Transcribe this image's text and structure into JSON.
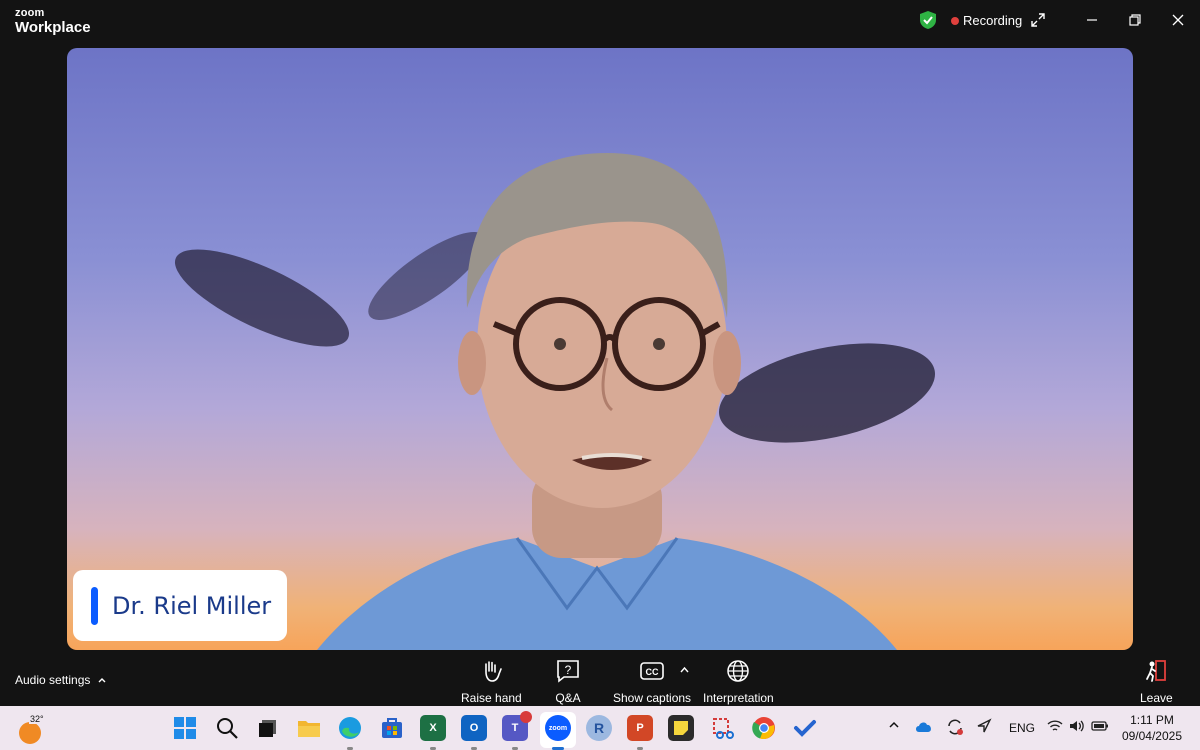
{
  "app": {
    "brand": "zoom",
    "product": "Workplace"
  },
  "titlebar": {
    "status": "Recording",
    "colors": {
      "shield": "#2fb344",
      "rec_dot": "#e0403d"
    }
  },
  "window_controls": [
    "minimize-icon",
    "restore-icon",
    "close-icon"
  ],
  "participant": {
    "name": "Dr. Riel Miller",
    "accent": "#0b5cff"
  },
  "controls": {
    "audio_settings": "Audio settings",
    "buttons": [
      {
        "label": "Raise hand",
        "icon": "hand-icon"
      },
      {
        "label": "Q&A",
        "icon": "qa-icon"
      },
      {
        "label": "Show captions",
        "icon": "cc-icon"
      },
      {
        "label": "Interpretation",
        "icon": "globe-icon"
      }
    ],
    "leave": "Leave",
    "leave_color": "#e0403d"
  },
  "taskbar": {
    "weather_temp": "32°",
    "apps": [
      {
        "name": "start",
        "icon": "windows-icon"
      },
      {
        "name": "search",
        "icon": "search-icon"
      },
      {
        "name": "task-view",
        "icon": "task-view-icon"
      },
      {
        "name": "file-explorer",
        "icon": "folder-icon"
      },
      {
        "name": "edge",
        "icon": "edge-icon"
      },
      {
        "name": "store",
        "icon": "store-icon"
      },
      {
        "name": "excel",
        "icon": "excel-icon",
        "text": "X"
      },
      {
        "name": "outlook",
        "icon": "outlook-icon",
        "text": "O"
      },
      {
        "name": "teams",
        "icon": "teams-icon",
        "text": "T"
      },
      {
        "name": "zoom",
        "icon": "zoom-icon",
        "text": "zoom"
      },
      {
        "name": "r",
        "icon": "r-icon",
        "text": "R"
      },
      {
        "name": "powerpoint",
        "icon": "powerpoint-icon",
        "text": "P"
      },
      {
        "name": "sticky-notes",
        "icon": "sticky-notes-icon"
      },
      {
        "name": "snipping-tool",
        "icon": "snipping-icon"
      },
      {
        "name": "chrome",
        "icon": "chrome-icon"
      },
      {
        "name": "todo",
        "icon": "todo-icon"
      }
    ],
    "tray": {
      "language": "ENG",
      "time": "1:11 PM",
      "date": "09/04/2025"
    }
  }
}
